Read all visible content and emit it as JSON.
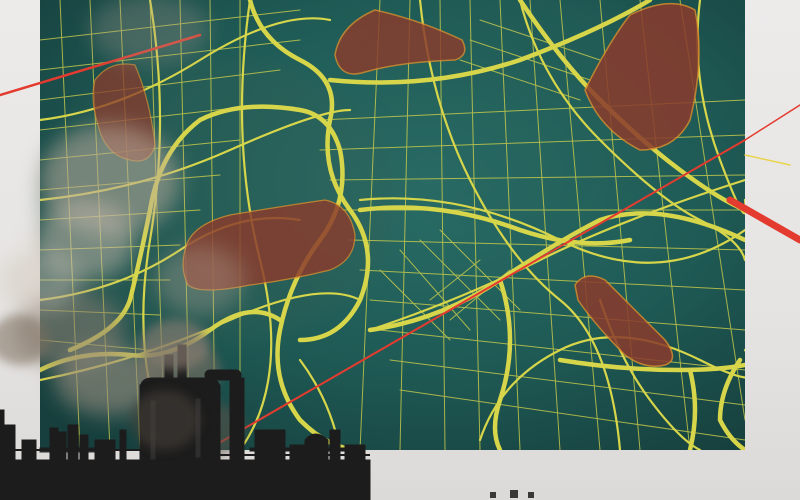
{
  "image": {
    "subject": "",
    "palette": {
      "background": "#e9e7e6",
      "map_fill": "#1f5a55",
      "roads": "#d7d64a",
      "zones": "#8a3b2c",
      "zone_outline": "#d98a2a",
      "laser_lines": "#e33b2f",
      "smoke": "#9a8b7c",
      "factory": "#1c1c1c"
    },
    "elements": {
      "map": "city-map-icon",
      "zones": "highlighted-district-icon",
      "lines": "red-line-icon",
      "factory": "factory-silhouette-icon",
      "smoke": "smoke-cloud-icon"
    }
  }
}
